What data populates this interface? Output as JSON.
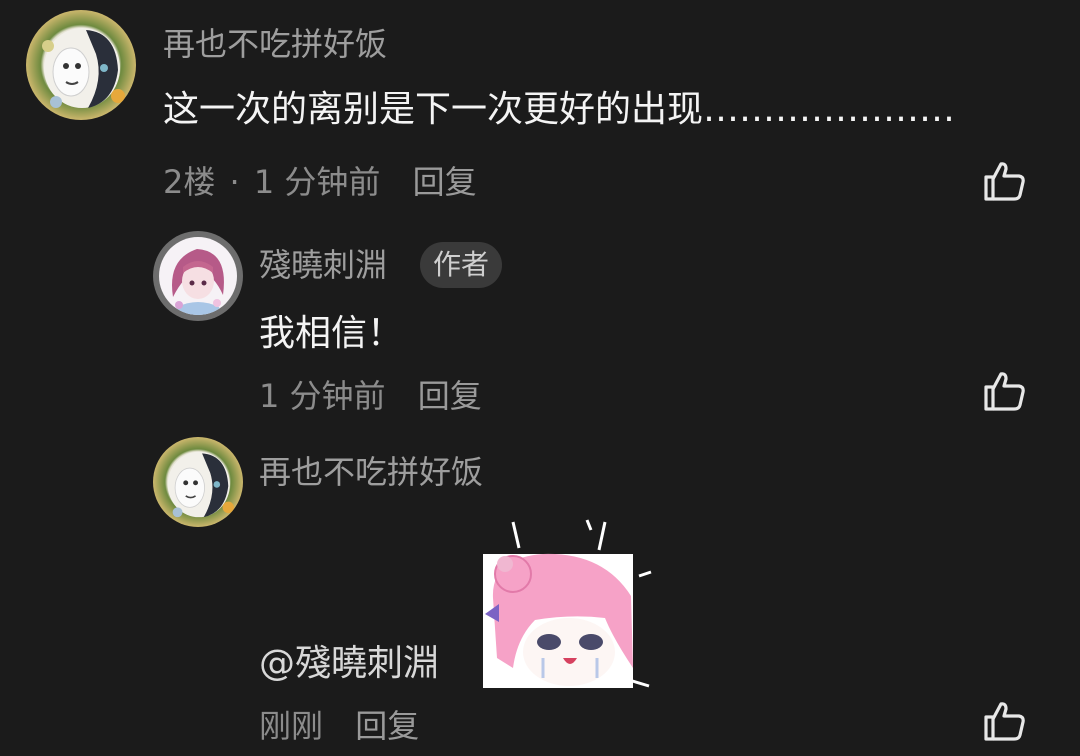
{
  "comments": [
    {
      "username": "再也不吃拼好饭",
      "content": "这一次的离别是下一次更好的出现…………………",
      "floor": "2楼",
      "separator": "·",
      "time": "1 分钟前",
      "reply_label": "回复"
    }
  ],
  "replies": [
    {
      "username": "殘曉刺淵",
      "badge": "作者",
      "content": "我相信！",
      "time": "1 分钟前",
      "reply_label": "回复"
    },
    {
      "username": "再也不吃拼好饭",
      "mention": "@殘曉刺淵",
      "time": "刚刚",
      "reply_label": "回复"
    }
  ],
  "icons": {
    "like": "thumbs-up-icon"
  },
  "colors": {
    "background": "#1b1b1b",
    "username": "#9e9e9e",
    "text": "#f4f4f4",
    "meta": "#8c8c8c"
  }
}
